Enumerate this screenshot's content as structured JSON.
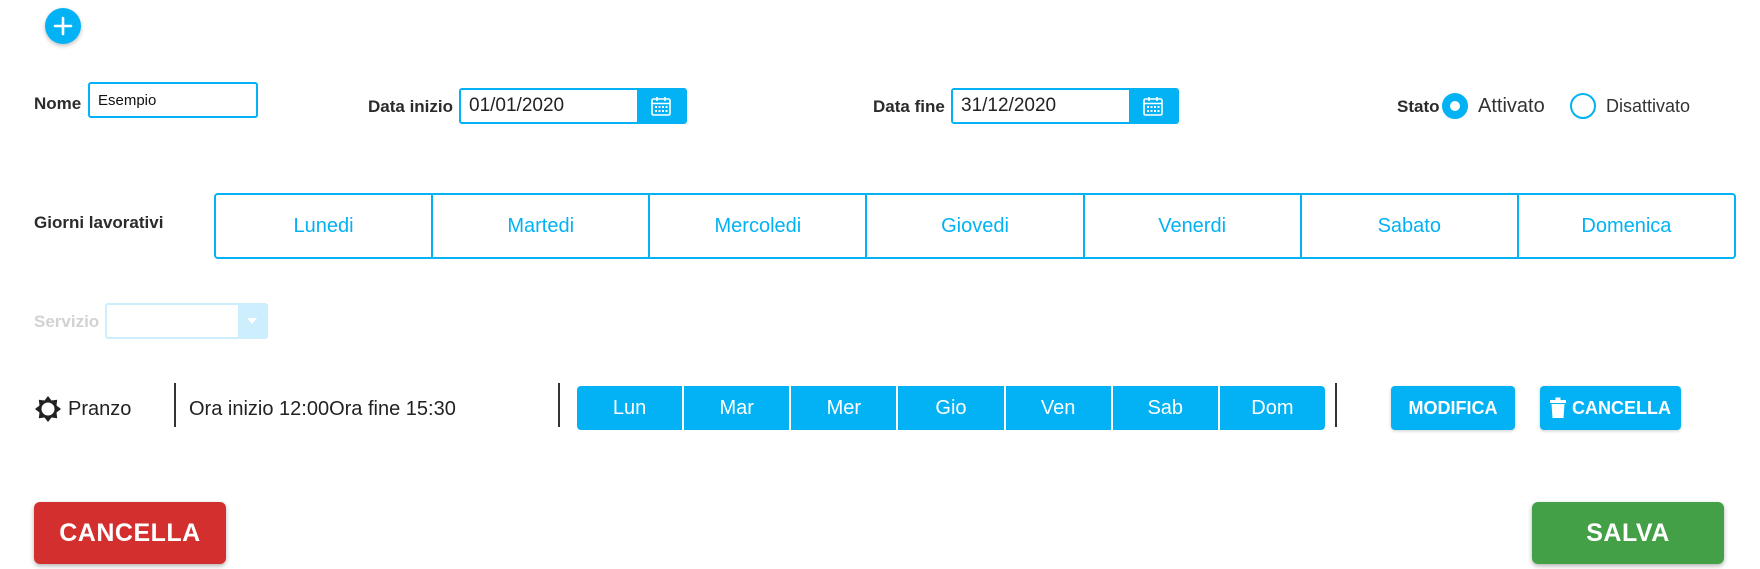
{
  "colors": {
    "accent": "#03b2f4",
    "danger": "#d32f2f",
    "success": "#43a047",
    "disabled": "#cdeefc"
  },
  "icons": {
    "add": "plus-icon",
    "calendar": "calendar-icon",
    "dropdown": "chevron-down-icon",
    "service": "gear-icon",
    "delete": "trash-icon"
  },
  "form": {
    "nome_label": "Nome",
    "nome_value": "Esempio",
    "data_inizio_label": "Data inizio",
    "data_inizio_value": "01/01/2020",
    "data_fine_label": "Data fine",
    "data_fine_value": "31/12/2020",
    "stato_label": "Stato",
    "stato_options": [
      {
        "label": "Attivato",
        "selected": true
      },
      {
        "label": "Disattivato",
        "selected": false
      }
    ]
  },
  "giorni": {
    "label": "Giorni lavorativi",
    "days": [
      "Lunedi",
      "Martedi",
      "Mercoledi",
      "Giovedi",
      "Venerdi",
      "Sabato",
      "Domenica"
    ]
  },
  "servizio": {
    "label": "Servizio",
    "value": ""
  },
  "service_row": {
    "name": "Pranzo",
    "time_text": "Ora inizio 12:00Ora fine 15:30",
    "days": [
      "Lun",
      "Mar",
      "Mer",
      "Gio",
      "Ven",
      "Sab",
      "Dom"
    ],
    "modify_label": "MODIFICA",
    "delete_label": "CANCELLA"
  },
  "footer": {
    "cancel_label": "CANCELLA",
    "save_label": "SALVA"
  }
}
